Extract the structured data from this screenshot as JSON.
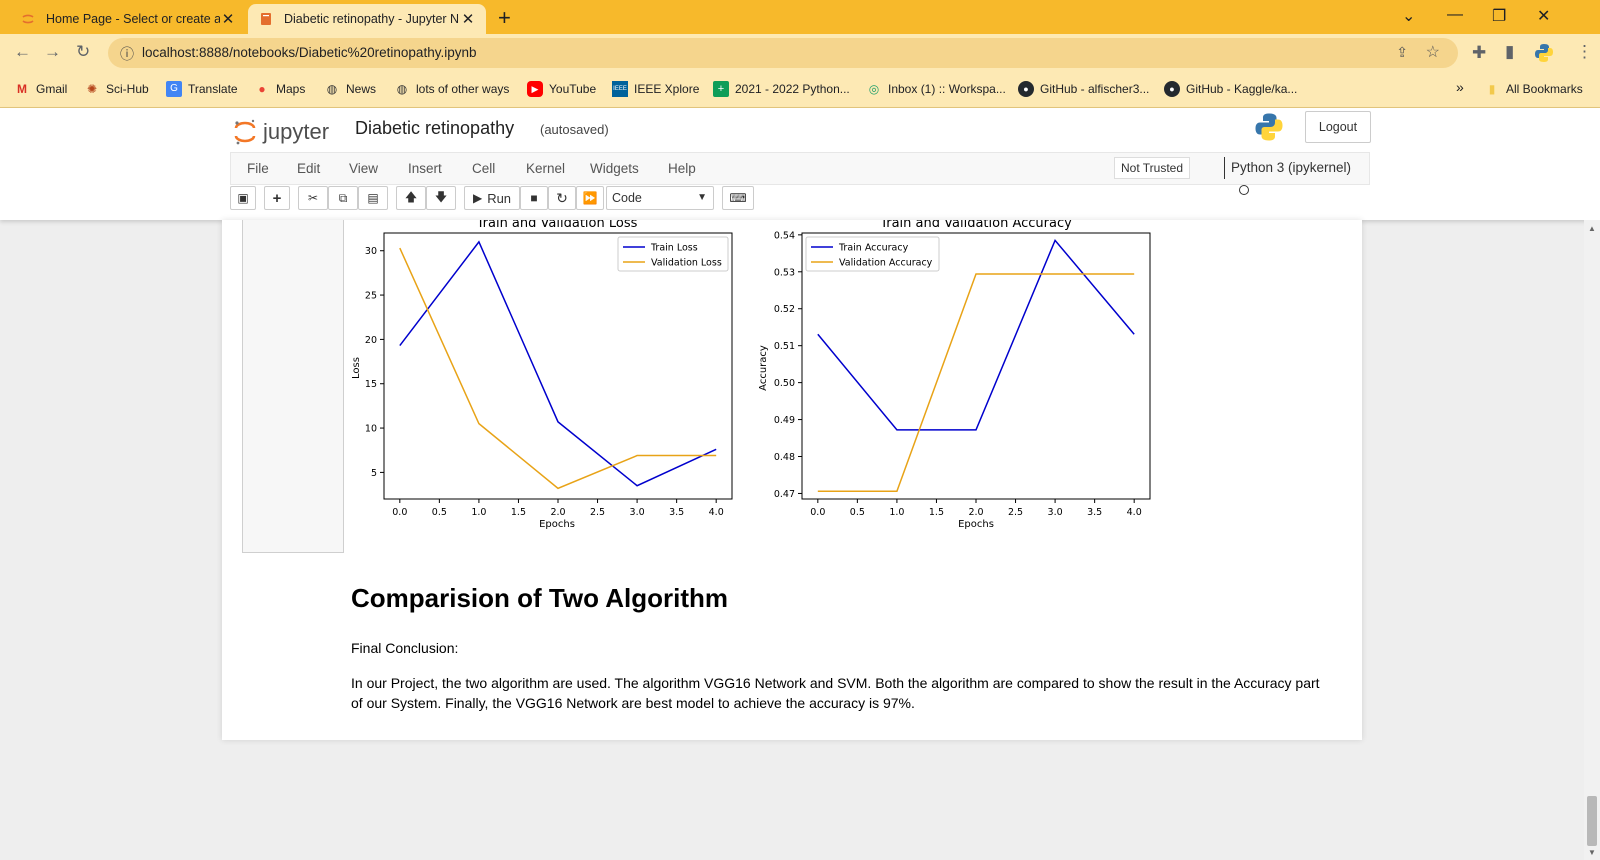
{
  "browser": {
    "tabs": [
      {
        "title": "Home Page - Select or create a n",
        "active": false
      },
      {
        "title": "Diabetic retinopathy - Jupyter N",
        "active": true
      }
    ],
    "new_tab": "+",
    "window": {
      "minimize": "—",
      "restore": "❐",
      "close": "✕",
      "tabs_menu": "⌄"
    },
    "url": "localhost:8888/notebooks/Diabetic%20retinopathy.ipynb",
    "bookmarks": [
      {
        "label": "Gmail",
        "icon": "gmail-icon"
      },
      {
        "label": "Sci-Hub",
        "icon": "scihub-icon"
      },
      {
        "label": "Translate",
        "icon": "translate-icon"
      },
      {
        "label": "Maps",
        "icon": "maps-icon"
      },
      {
        "label": "News",
        "icon": "globe-icon"
      },
      {
        "label": "lots of other ways",
        "icon": "globe-icon"
      },
      {
        "label": "YouTube",
        "icon": "youtube-icon"
      },
      {
        "label": "IEEE Xplore",
        "icon": "ieee-icon"
      },
      {
        "label": "2021 - 2022 Python...",
        "icon": "sheets-icon"
      },
      {
        "label": "Inbox (1) :: Workspa...",
        "icon": "inbox-icon"
      },
      {
        "label": "GitHub - alfischer3...",
        "icon": "github-icon"
      },
      {
        "label": "GitHub - Kaggle/ka...",
        "icon": "github-icon"
      }
    ],
    "bookmarks_overflow": "»",
    "all_bookmarks": "All Bookmarks"
  },
  "jupyter": {
    "logo_text": "jupyter",
    "notebook_name": "Diabetic retinopathy",
    "save_status": "(autosaved)",
    "logout": "Logout",
    "menu": [
      "File",
      "Edit",
      "View",
      "Insert",
      "Cell",
      "Kernel",
      "Widgets",
      "Help"
    ],
    "trust": "Not Trusted",
    "kernel": "Python 3 (ipykernel)",
    "run_label": "Run",
    "cell_type": "Code"
  },
  "markdown": {
    "heading": "Comparision of Two Algorithm",
    "para1": "Final Conclusion:",
    "para2": "In our Project, the two algorithm are used. The algorithm VGG16 Network and SVM. Both the algorithm are compared to show the result in the Accuracy part of our System. Finally, the VGG16 Network are best model to achieve the accuracy is 97%."
  },
  "colors": {
    "train": "#0000cd",
    "validation": "#e8a317",
    "tabstrip": "#f7b92b",
    "navbar": "#fde9b4"
  },
  "chart_data": [
    {
      "type": "line",
      "title": "Train and Validation Loss",
      "xlabel": "Epochs",
      "ylabel": "Loss",
      "x": [
        0,
        1,
        2,
        3,
        4
      ],
      "xticks": [
        "0.0",
        "0.5",
        "1.0",
        "1.5",
        "2.0",
        "2.5",
        "3.0",
        "3.5",
        "4.0"
      ],
      "yticks": [
        "5",
        "10",
        "15",
        "20",
        "25",
        "30"
      ],
      "xlim": [
        -0.2,
        4.2
      ],
      "ylim": [
        2,
        32
      ],
      "legend": "top-right",
      "series": [
        {
          "name": "Train Loss",
          "values": [
            19.3,
            31.0,
            10.7,
            3.5,
            7.6
          ]
        },
        {
          "name": "Validation Loss",
          "values": [
            30.3,
            10.5,
            3.2,
            6.9,
            6.9
          ]
        }
      ]
    },
    {
      "type": "line",
      "title": "Train and Validation Accuracy",
      "xlabel": "Epochs",
      "ylabel": "Accuracy",
      "x": [
        0,
        1,
        2,
        3,
        4
      ],
      "xticks": [
        "0.0",
        "0.5",
        "1.0",
        "1.5",
        "2.0",
        "2.5",
        "3.0",
        "3.5",
        "4.0"
      ],
      "yticks": [
        "0.47",
        "0.48",
        "0.49",
        "0.50",
        "0.51",
        "0.52",
        "0.53",
        "0.54"
      ],
      "xlim": [
        -0.2,
        4.2
      ],
      "ylim": [
        0.4685,
        0.5405
      ],
      "legend": "top-left",
      "series": [
        {
          "name": "Train Accuracy",
          "values": [
            0.5131,
            0.4872,
            0.4872,
            0.5385,
            0.5131
          ]
        },
        {
          "name": "Validation Accuracy",
          "values": [
            0.4706,
            0.4706,
            0.5294,
            0.5294,
            0.5294
          ]
        }
      ]
    }
  ]
}
